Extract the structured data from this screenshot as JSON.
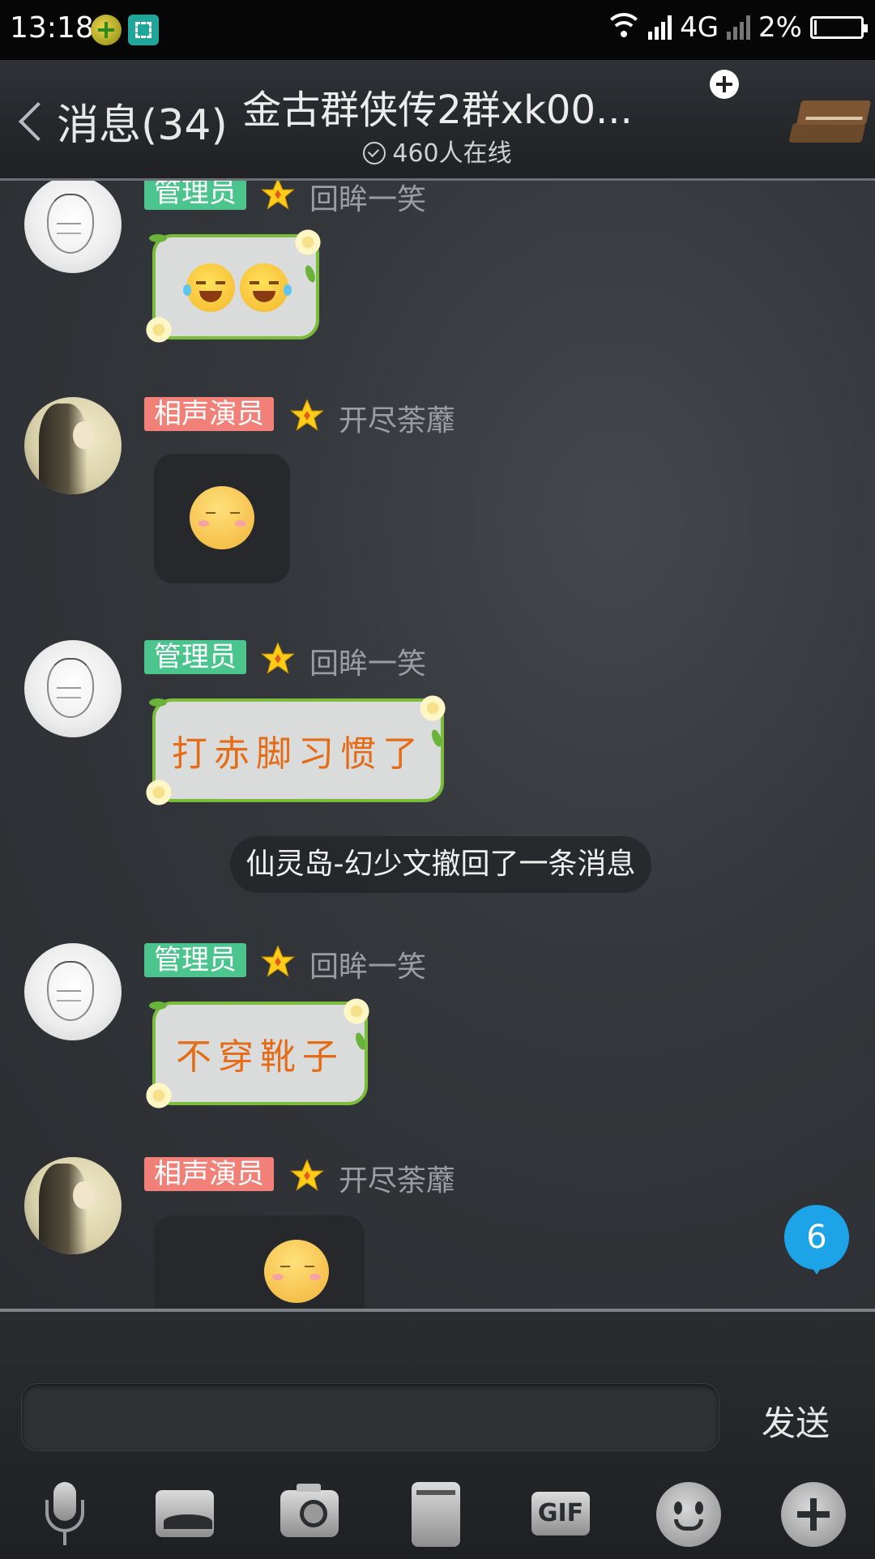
{
  "status_bar": {
    "time": "13:18",
    "network": "4G",
    "battery": "2%"
  },
  "header": {
    "back_label": "消息(34)",
    "title": "金古群侠传2群xk00...",
    "online_count": "460人在线"
  },
  "messages": [
    {
      "badge": "管理员",
      "badge_color": "#4bc48e",
      "nickname": "回眸一笑",
      "content_type": "emoji",
      "content": "😂😂"
    },
    {
      "badge": "相声演员",
      "badge_color": "#f08078",
      "nickname": "开尽荼蘼",
      "content_type": "sticker",
      "content": "sticker-face"
    },
    {
      "badge": "管理员",
      "badge_color": "#4bc48e",
      "nickname": "回眸一笑",
      "content_type": "text",
      "content": "打赤脚习惯了"
    },
    {
      "badge": "管理员",
      "badge_color": "#4bc48e",
      "nickname": "回眸一笑",
      "content_type": "text",
      "content": "不穿靴子"
    },
    {
      "badge": "相声演员",
      "badge_color": "#f08078",
      "nickname": "开尽荼蘼",
      "content_type": "sticker",
      "content": "sticker-face"
    }
  ],
  "system_message": "仙灵岛-幻少文撤回了一条消息",
  "unread_count": "6",
  "input_bar": {
    "send_label": "发送",
    "tools": [
      "mic-icon",
      "image-icon",
      "camera-icon",
      "file-icon",
      "gif-icon",
      "emoji-icon",
      "plus-icon"
    ],
    "gif_label": "GIF"
  },
  "colors": {
    "admin_badge": "#4bc48e",
    "performer_badge": "#f08078",
    "bubble_border": "#7bbd3a",
    "bubble_text": "#e66b17",
    "unread_badge": "#1ca3e8"
  }
}
